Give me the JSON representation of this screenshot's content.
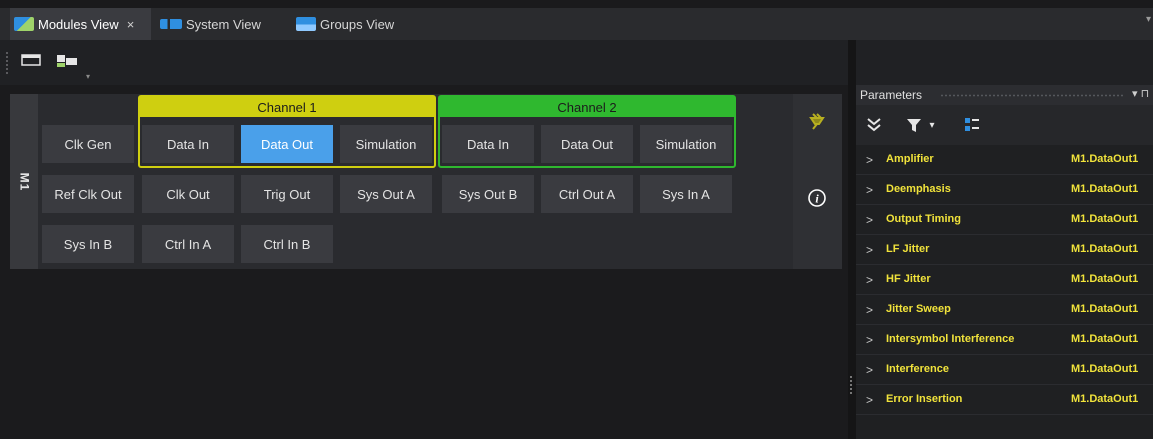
{
  "tabs": [
    {
      "label": "Modules View",
      "close": "×",
      "active": true
    },
    {
      "label": "System View",
      "active": false
    },
    {
      "label": "Groups View",
      "active": false
    }
  ],
  "tab_overflow": "▾",
  "toolbar": {
    "icons": [
      "window-icon",
      "modules-icon"
    ],
    "more": "▾"
  },
  "module": {
    "label": "M1",
    "standalone_row1": [
      "Clk Gen"
    ],
    "channel1": {
      "title": "Channel 1",
      "buttons": [
        "Data In",
        "Data Out",
        "Simulation"
      ],
      "selected": "Data Out",
      "color": "#cfcf10"
    },
    "channel2": {
      "title": "Channel 2",
      "buttons": [
        "Data In",
        "Data Out",
        "Simulation"
      ],
      "color": "#2fb82f"
    },
    "row2": [
      "Ref Clk Out",
      "Clk Out",
      "Trig Out",
      "Sys Out A",
      "Sys Out B",
      "Ctrl Out A",
      "Sys In A"
    ],
    "row3": [
      "Sys In B",
      "Ctrl In A",
      "Ctrl In B"
    ],
    "side_icons": [
      "plug-icon",
      "info-icon"
    ]
  },
  "parameters": {
    "title": "Parameters",
    "pin": "▾ ⊓",
    "toolbar": {
      "collapse": "»",
      "filter": "▼",
      "filter_dropdown": "▾"
    },
    "rows": [
      {
        "name": "Amplifier",
        "value": "M1.DataOut1"
      },
      {
        "name": "Deemphasis",
        "value": "M1.DataOut1"
      },
      {
        "name": "Output Timing",
        "value": "M1.DataOut1"
      },
      {
        "name": "LF Jitter",
        "value": "M1.DataOut1"
      },
      {
        "name": "HF Jitter",
        "value": "M1.DataOut1"
      },
      {
        "name": "Jitter Sweep",
        "value": "M1.DataOut1"
      },
      {
        "name": "Intersymbol Interference",
        "value": "M1.DataOut1"
      },
      {
        "name": "Interference",
        "value": "M1.DataOut1"
      },
      {
        "name": "Error Insertion",
        "value": "M1.DataOut1"
      }
    ]
  },
  "colors": {
    "accent": "#4aa0ea",
    "param_text": "#f1e33b",
    "channel1": "#cfcf10",
    "channel2": "#2fb82f"
  }
}
